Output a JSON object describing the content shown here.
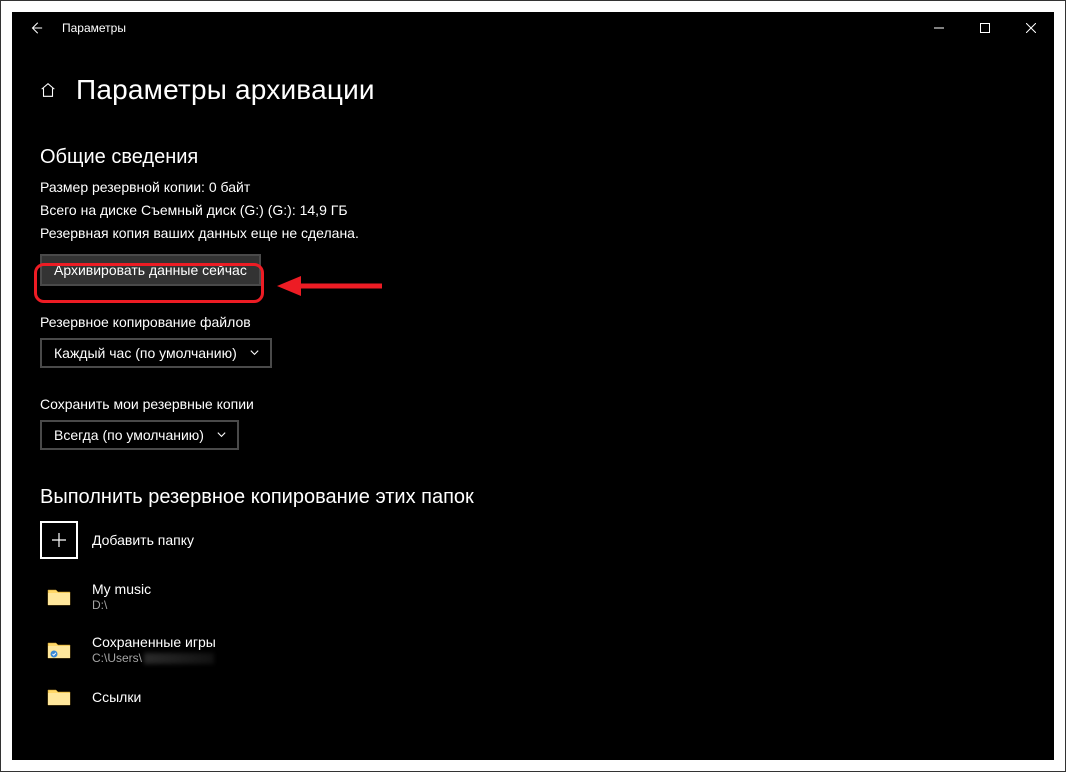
{
  "titlebar": {
    "app_title": "Параметры"
  },
  "header": {
    "page_title": "Параметры архивации"
  },
  "overview": {
    "heading": "Общие сведения",
    "backup_size": "Размер резервной копии: 0 байт",
    "total_space": "Всего на диске Съемный диск (G:) (G:): 14,9 ГБ",
    "status": "Резервная копия ваших данных еще не сделана.",
    "button_label": "Архивировать данные сейчас"
  },
  "frequency": {
    "label": "Резервное копирование файлов",
    "selected": "Каждый час (по умолчанию)"
  },
  "retention": {
    "label": "Сохранить мои резервные копии",
    "selected": "Всегда (по умолчанию)"
  },
  "folders": {
    "heading": "Выполнить резервное копирование этих папок",
    "add_label": "Добавить папку",
    "items": [
      {
        "name": "My music",
        "path": "D:\\"
      },
      {
        "name": "Сохраненные игры",
        "path": "C:\\Users\\"
      },
      {
        "name": "Ссылки",
        "path": ""
      }
    ]
  }
}
